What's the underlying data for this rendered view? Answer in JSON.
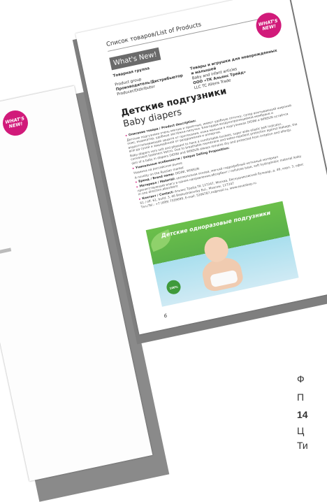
{
  "back_page": {
    "badge_text": "WHAT'S NEW!"
  },
  "front_page": {
    "header_title": "Список товаров/List of Products",
    "whats_new_label": "What's New!",
    "badge_text": "WHAT'S NEW!",
    "meta": {
      "group_label_ru": "Товарная группа",
      "group_label_en": "Product group",
      "producer_label_ru": "Производитель/Дистрибьютор",
      "producer_label_en": "Producer/Distributor",
      "group_value_ru": "Товары и игрушки для новорожденных и малышей",
      "group_value_en": "Baby and infant articles",
      "producer_value_ru": "ООО «ТК Альянс Трейд»",
      "producer_value_en": "LLC TC Allens Trade"
    },
    "product_title_ru": "Детские подгузники",
    "product_title_en": "Baby diapers",
    "description": {
      "desc_label": "Описание товара / Product description:",
      "desc_ru": "Детские подгузники очень мягкие и приятные, имеют удобную сеточку, супер впитывающий широкий пояс, индикатор, удобные застёжки-липучки. Благодаря воздухопроницаемой мембране и водоотталкивающей защите от протекания, кожа малыша в подгузниках DIDINI и WINSUN остаётся всегда сухой и защищённой от раздражения и аллергии.",
      "desc_en": "Baby diapers very soft and pleasant to have a comfortable buckets, super wide elastic belt indicator, convenient fasteners Velcro. Due to breathable membrane and water-repellent protection against leakage, the skin of a baby in diapers DIDINI and WINSUN always remains dry and protected from irritation and allergy.",
      "usp_label": "Уникальные особенности / Unique Selling Proposition:",
      "usp_ru": "Новинка на российском рынке",
      "usp_en": "A novelty on the Russian market",
      "brand_label": "Бренд / Brand name:",
      "brand_value": "DIDINI, WINSUN",
      "material_label": "Материал / Material:",
      "material_ru": "целлюлозная основа, мягкий гидрофобный нетканый материал препятствующий влагу в одном направлении,абсорбент",
      "material_en": "cellulose base, soft hydrophobic material leaky in one direction,absorbent",
      "contact_label": "Контакт / Contact:",
      "contact_value": "Альянс Трейд ТК 127247, Москва, Бескудниковский бульвар, д. 46, корп. 3, офис 61 / off. 61, build. 3, 46 Beskudnikovsky Bul., Moscow, 127247",
      "contact_phone": "Тел./Tel.: +7 (499) 7559699, E-mail: 5266787,ns@mail.ru, www.esuesbop.ru"
    },
    "banner_text": "Детские одноразовые подгузники",
    "banner_pack_text": "100%",
    "page_number": "6"
  },
  "side_text": {
    "line1": "Ф",
    "line2": "П",
    "line3": "14",
    "line4": "Ц",
    "line5": "Ти"
  }
}
